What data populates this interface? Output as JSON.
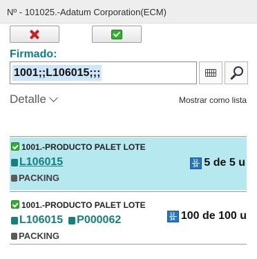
{
  "window": {
    "title": "Nº - 101025.-Adatum Corporation(ECM)"
  },
  "colors": {
    "accent": "#0d7f8a",
    "selected_row": "#b5e8ef",
    "cancel": "#cc1e1e",
    "confirm": "#2fb02f",
    "count_icon": "#2476c4"
  },
  "toolbar": {
    "cancel_icon": "x-icon",
    "confirm_icon": "check-icon"
  },
  "form": {
    "label": "Firmado:",
    "input_value": "1001;;L106015;;;",
    "keyboard_icon": "keyboard-icon",
    "search_icon": "search-icon"
  },
  "view": {
    "detail_label": "Detalle",
    "list_toggle": "Mostrar como lista"
  },
  "items": [
    {
      "product": "1001.-PRODUCTO PALET LOTE",
      "lot": "L106015",
      "pallet": "",
      "packing": "PACKING",
      "count_icon_top": "12",
      "count_icon_bottom": "34",
      "quantity": "5 de 5 u",
      "selected": true
    },
    {
      "product": "1001.-PRODUCTO PALET LOTE",
      "lot": "L106015",
      "pallet": "P000062",
      "packing": "PACKING",
      "count_icon_top": "12",
      "count_icon_bottom": "34",
      "quantity": "100 de 100 u",
      "selected": false
    }
  ]
}
